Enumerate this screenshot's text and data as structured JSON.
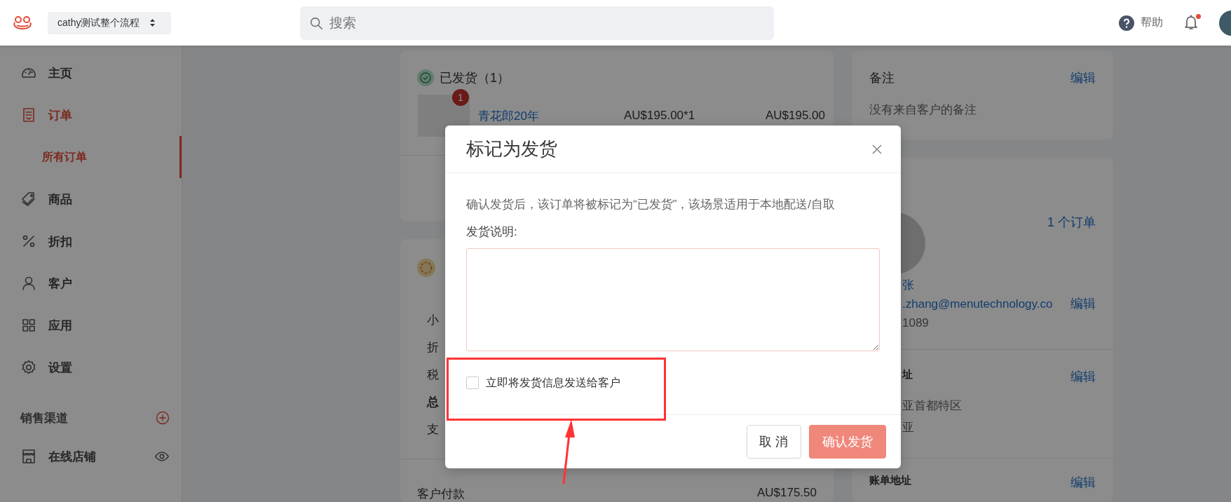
{
  "top_bar": {
    "store_selector": "cathy测试整个流程",
    "search": {
      "placeholder": "搜索"
    },
    "help": "帮助",
    "notifications": {
      "has_unread": true
    }
  },
  "sidebar": {
    "items": [
      {
        "label": "主页",
        "selected": false
      },
      {
        "label": "订单",
        "selected": true,
        "children": [
          {
            "label": "所有订单",
            "selected": true
          }
        ]
      },
      {
        "label": "商品",
        "selected": false
      },
      {
        "label": "折扣",
        "selected": false
      },
      {
        "label": "客户",
        "selected": false
      },
      {
        "label": "应用",
        "selected": false
      },
      {
        "label": "设置",
        "selected": false
      }
    ],
    "sales_channels": {
      "title": "销售渠道",
      "items": [
        {
          "label": "在线店铺"
        }
      ]
    }
  },
  "shipped_card": {
    "title": "已发货（1）",
    "items": [
      {
        "badge": "1",
        "name": "青花郎20年",
        "unit_price": "AU$195.00*1",
        "total": "AU$195.00"
      }
    ]
  },
  "payment_card": {
    "rows": [
      {
        "label": "小",
        "bold": false
      },
      {
        "label": "折",
        "bold": false
      },
      {
        "label": "税",
        "bold": false
      },
      {
        "label": "总",
        "bold": true
      },
      {
        "label": "支",
        "bold": false
      }
    ],
    "customer_payment": {
      "label": "客户付款",
      "amount": "AU$175.50"
    }
  },
  "notes_card": {
    "title": "备注",
    "edit": "编辑",
    "text": "没有来自客户的备注"
  },
  "customer_card": {
    "orders_link": "1 个订单",
    "name": "张",
    "email": ".zhang@menutechnology.co",
    "edit": "编辑",
    "phone": "1089",
    "shipping_address": {
      "title": "址",
      "edit": "编辑",
      "lines": [
        "亚首都特区",
        "亚"
      ]
    },
    "billing_address": {
      "title": "账单地址",
      "edit": "编辑"
    }
  },
  "dialog": {
    "title": "标记为发货",
    "description": "确认发货后，该订单将被标记为“已发货”，该场景适用于本地配送/自取",
    "field_label": "发货说明:",
    "notify": {
      "label": "立即将发货信息发送给客户",
      "checked": false
    },
    "buttons": [
      {
        "label": "取 消",
        "kind": "secondary"
      },
      {
        "label": "确认发货",
        "kind": "primary"
      }
    ]
  }
}
